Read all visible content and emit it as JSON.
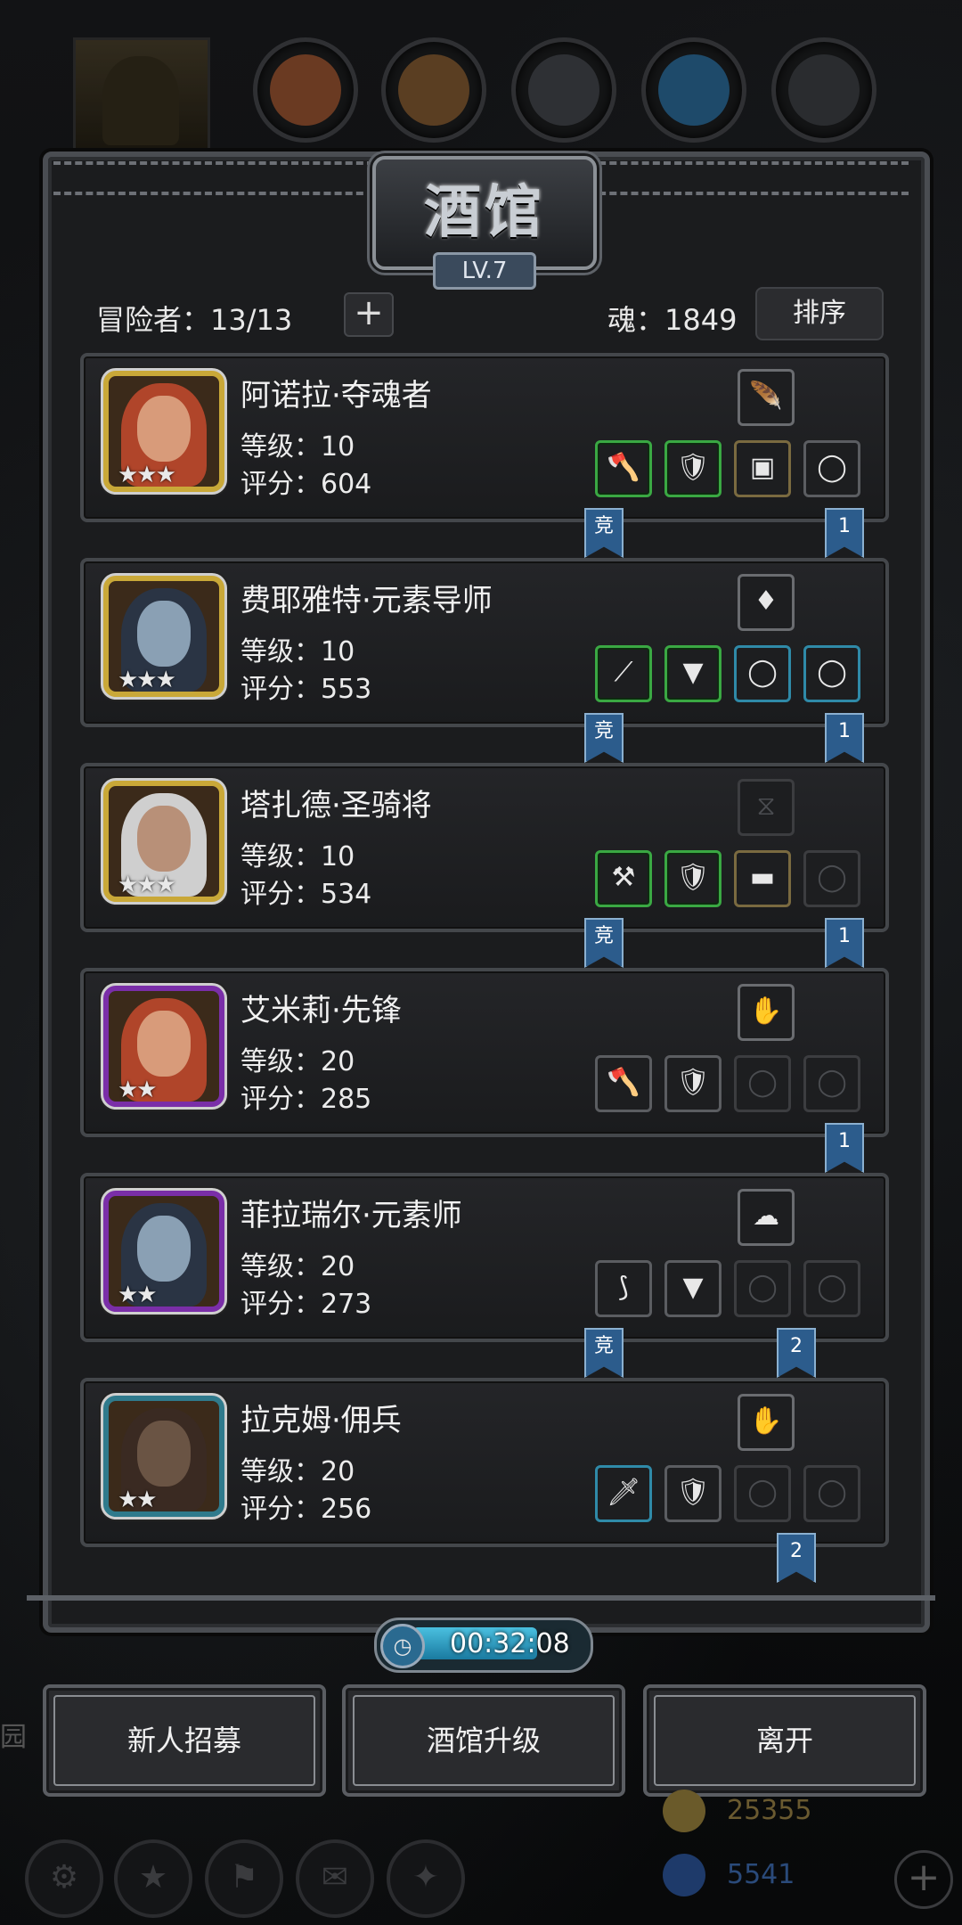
{
  "header": {
    "title": "酒馆",
    "level": "LV.7"
  },
  "info": {
    "adventurers_label": "冒险者：13/13",
    "add_symbol": "+",
    "soul_label": "魂：1849",
    "sort_label": "排序"
  },
  "stars_3": "★★★",
  "stars_2": "★★",
  "competition_tag": "竞",
  "heroes": [
    {
      "name": "阿诺拉·夺魂者",
      "level": "等级：10",
      "score": "评分：604",
      "rank_badge": "1"
    },
    {
      "name": "费耶雅特·元素导师",
      "level": "等级：10",
      "score": "评分：553",
      "rank_badge": "1"
    },
    {
      "name": "塔扎德·圣骑将",
      "level": "等级：10",
      "score": "评分：534",
      "rank_badge": "1"
    },
    {
      "name": "艾米莉·先锋",
      "level": "等级：20",
      "score": "评分：285",
      "rank_badge": "1"
    },
    {
      "name": "菲拉瑞尔·元素师",
      "level": "等级：20",
      "score": "评分：273",
      "rank_badge": "2"
    },
    {
      "name": "拉克姆·佣兵",
      "level": "等级：20",
      "score": "评分：256",
      "rank_badge": "2"
    }
  ],
  "timer": "00:32:08",
  "buttons": {
    "recruit": "新人招募",
    "upgrade": "酒馆升级",
    "leave": "离开"
  },
  "currency": {
    "gold": "25355",
    "gems": "5541"
  },
  "side_text": "园",
  "colors": {
    "accent_gold": "#c9a838",
    "accent_purple": "#7a2ea8",
    "accent_teal": "#2f7a8c",
    "badge_blue": "#2c5c8c",
    "equip_green": "#3aa843"
  }
}
